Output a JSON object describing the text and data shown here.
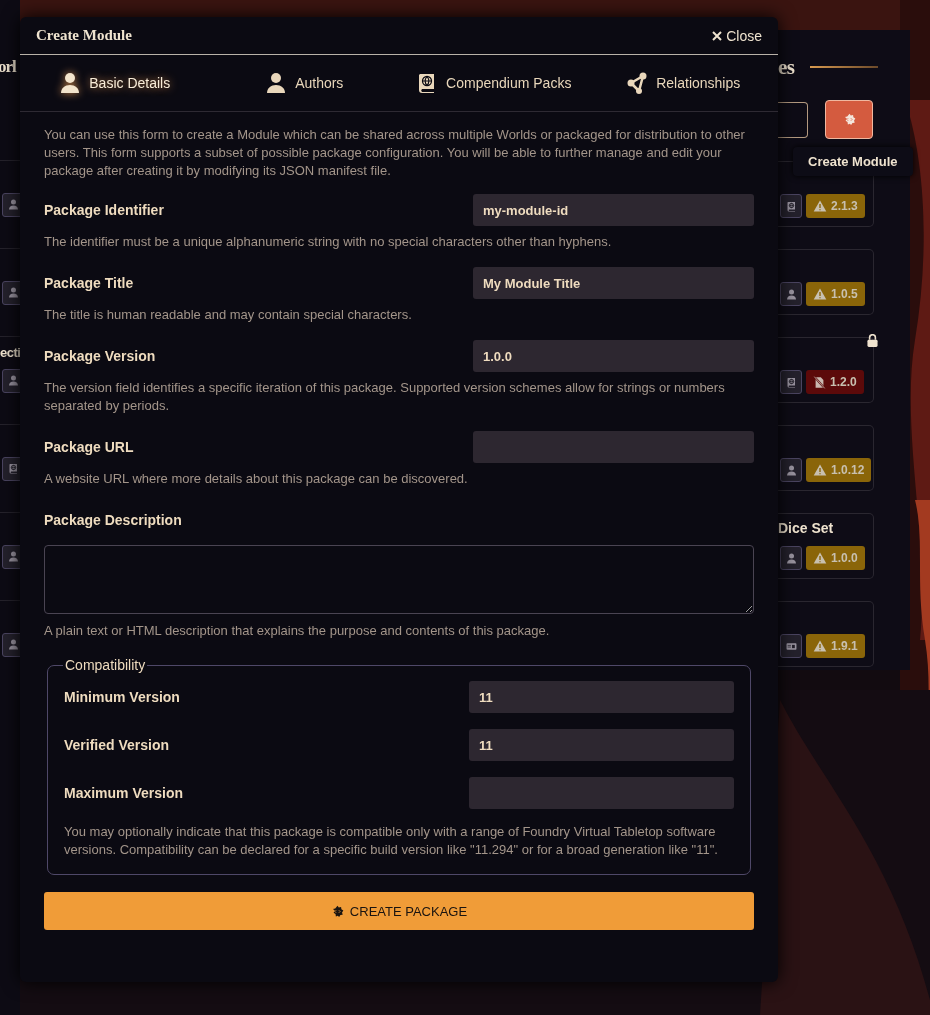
{
  "background": {
    "left_heading": "orl",
    "right_heading": "es",
    "tooltip": "Create Module",
    "modules": [
      {
        "kind": "warning",
        "version": "2.1.3",
        "locked": false
      },
      {
        "kind": "warning",
        "version": "1.0.5",
        "locked": false
      },
      {
        "kind": "error",
        "version": "1.2.0",
        "locked": true,
        "left_title": "ecti"
      },
      {
        "kind": "warning",
        "version": "1.0.12",
        "locked": false
      },
      {
        "kind": "warning",
        "version": "1.0.0",
        "locked": false,
        "right_title": "Dice Set"
      },
      {
        "kind": "warning",
        "version": "1.9.1",
        "locked": false
      }
    ]
  },
  "dialog": {
    "title": "Create Module",
    "close_label": "Close",
    "tabs": [
      {
        "label": "Basic Details",
        "selected": true
      },
      {
        "label": "Authors",
        "selected": false
      },
      {
        "label": "Compendium Packs",
        "selected": false
      },
      {
        "label": "Relationships",
        "selected": false
      }
    ],
    "intro": "You can use this form to create a Module which can be shared across multiple Worlds or packaged for distribution to other users. This form supports a subset of possible package configuration. You will be able to further manage and edit your package after creating it by modifying its JSON manifest file.",
    "fields": [
      {
        "kind": "text",
        "label": "Package Identifier",
        "value": "my-module-id",
        "hint": "The identifier must be a unique alphanumeric string with no special characters other than hyphens."
      },
      {
        "kind": "text",
        "label": "Package Title",
        "value": "My Module Title",
        "hint": "The title is human readable and may contain special characters."
      },
      {
        "kind": "text",
        "label": "Package Version",
        "value": "1.0.0",
        "hint": "The version field identifies a specific iteration of this package. Supported version schemes allow for strings or numbers separated by periods."
      },
      {
        "kind": "text",
        "label": "Package URL",
        "hint": "A website URL where more details about this package can be discovered."
      },
      {
        "kind": "textarea",
        "label": "Package Description",
        "hint": "A plain text or HTML description that explains the purpose and contents of this package."
      }
    ],
    "compatibility": {
      "legend": "Compatibility",
      "fields": [
        {
          "label": "Minimum Version",
          "value": "11"
        },
        {
          "label": "Verified Version",
          "value": "11"
        },
        {
          "label": "Maximum Version"
        }
      ],
      "note": "You may optionally indicate that this package is compatible only with a range of Foundry Virtual Tabletop software versions. Compatibility can be declared for a specific build version like \"11.294\" or for a broad generation like \"11\"."
    },
    "submit_label": "CREATE PACKAGE"
  }
}
